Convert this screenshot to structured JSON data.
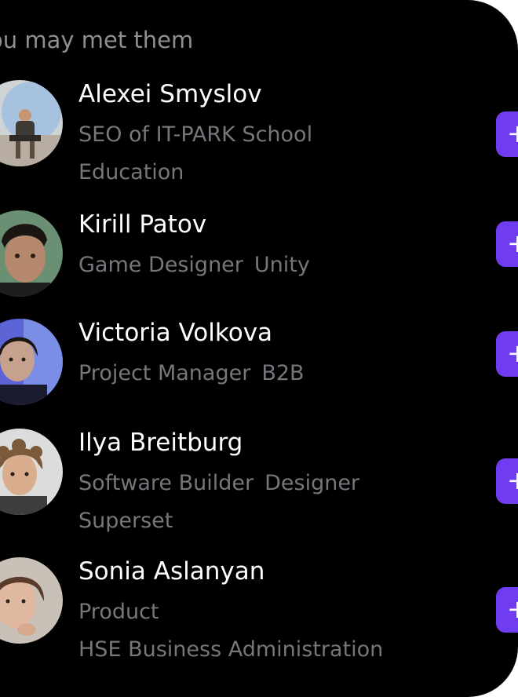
{
  "section": {
    "title": "ou may met them"
  },
  "people": [
    {
      "name": "Alexei Smyslov",
      "tags": [
        "SEO of IT-PARK School",
        "Education"
      ],
      "add_icon": "plus-icon"
    },
    {
      "name": "Kirill Patov",
      "tags": [
        "Game Designer",
        "Unity"
      ],
      "add_icon": "plus-icon"
    },
    {
      "name": "Victoria Volkova",
      "tags": [
        "Project Manager",
        "B2B"
      ],
      "add_icon": "plus-icon"
    },
    {
      "name": "Ilya Breitburg",
      "tags": [
        "Software Builder",
        "Designer",
        "Superset"
      ],
      "add_icon": "plus-icon"
    },
    {
      "name": "Sonia Aslanyan",
      "tags": [
        "Product",
        "HSE Business Administration"
      ],
      "add_icon": "plus-icon"
    }
  ],
  "colors": {
    "background": "#000000",
    "name": "#ffffff",
    "tag": "#76767c",
    "accent": "#6f3cf0"
  }
}
